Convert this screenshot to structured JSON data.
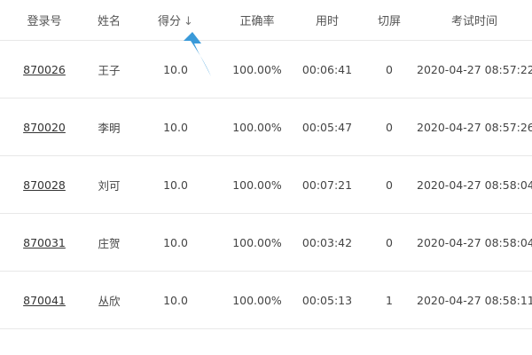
{
  "table": {
    "headers": {
      "login_id": "登录号",
      "name": "姓名",
      "score": "得分",
      "score_sort_icon": "arrow-down-icon",
      "accuracy": "正确率",
      "time_used": "用时",
      "switch_screen": "切屏",
      "exam_time": "考试时间"
    },
    "rows": [
      {
        "login_id": "870026",
        "name": "王子",
        "score": "10.0",
        "accuracy": "100.00%",
        "time_used": "00:06:41",
        "switch_screen": "0",
        "exam_time": "2020-04-27 08:57:22"
      },
      {
        "login_id": "870020",
        "name": "李明",
        "score": "10.0",
        "accuracy": "100.00%",
        "time_used": "00:05:47",
        "switch_screen": "0",
        "exam_time": "2020-04-27 08:57:26"
      },
      {
        "login_id": "870028",
        "name": "刘可",
        "score": "10.0",
        "accuracy": "100.00%",
        "time_used": "00:07:21",
        "switch_screen": "0",
        "exam_time": "2020-04-27 08:58:04"
      },
      {
        "login_id": "870031",
        "name": "庄贺",
        "score": "10.0",
        "accuracy": "100.00%",
        "time_used": "00:03:42",
        "switch_screen": "0",
        "exam_time": "2020-04-27 08:58:04"
      },
      {
        "login_id": "870041",
        "name": "丛欣",
        "score": "10.0",
        "accuracy": "100.00%",
        "time_used": "00:05:13",
        "switch_screen": "1",
        "exam_time": "2020-04-27 08:58:11"
      }
    ]
  },
  "annotation": {
    "arrow_color": "#3a9ad9"
  }
}
